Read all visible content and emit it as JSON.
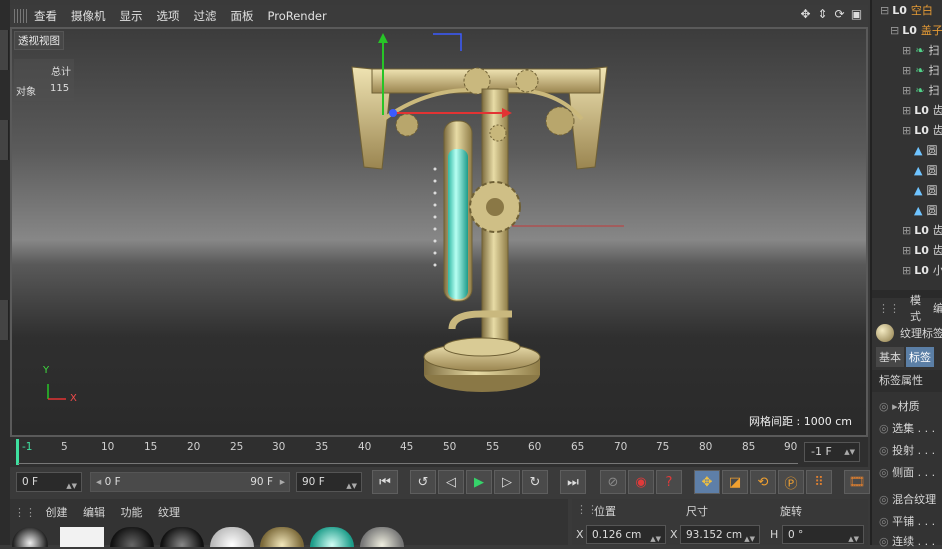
{
  "menu": [
    "查看",
    "摄像机",
    "显示",
    "选项",
    "过滤",
    "面板",
    "ProRender"
  ],
  "viewport": {
    "label": "透视视图",
    "stats_header": "总计",
    "stats_row_label": "对象",
    "stats_row_value": "115",
    "grid_spacing": "网格间距 : 1000 cm",
    "axis_y": "Y",
    "axis_x": "X"
  },
  "object_manager": {
    "items": [
      {
        "name": "空白",
        "type": "null",
        "selected": true
      },
      {
        "name": "盖子",
        "type": "null",
        "selected": true
      },
      {
        "name": "扫",
        "type": "sweep"
      },
      {
        "name": "扫",
        "type": "sweep"
      },
      {
        "name": "扫",
        "type": "sweep"
      },
      {
        "name": "齿",
        "type": "null"
      },
      {
        "name": "齿",
        "type": "null"
      },
      {
        "name": "圆",
        "type": "primitive"
      },
      {
        "name": "圆",
        "type": "primitive"
      },
      {
        "name": "圆",
        "type": "primitive"
      },
      {
        "name": "圆",
        "type": "primitive"
      },
      {
        "name": "齿",
        "type": "null"
      },
      {
        "name": "齿",
        "type": "null"
      },
      {
        "name": "小",
        "type": "null"
      }
    ]
  },
  "attributes": {
    "tabs": [
      "模式",
      "编"
    ],
    "material_tag": "纹理标签",
    "subtabs": [
      "基本",
      "标签"
    ],
    "section": "标签属性",
    "rows": [
      "材质",
      "选集 . . .",
      "投射 . . .",
      "侧面 . . .",
      "混合纹理",
      "平铺 . . .",
      "连续 . . ."
    ]
  },
  "timeline": {
    "ticks": [
      "0",
      "5",
      "10",
      "15",
      "20",
      "25",
      "30",
      "35",
      "40",
      "45",
      "50",
      "55",
      "60",
      "65",
      "70",
      "75",
      "80",
      "85",
      "90"
    ],
    "current_frame": "-1",
    "end_display": "-1 F"
  },
  "transport": {
    "start": "0 F",
    "range_start": "0 F",
    "range_end": "90 F",
    "end": "90 F"
  },
  "material_manager": {
    "menu": [
      "创建",
      "编辑",
      "功能",
      "纹理"
    ]
  },
  "coordinates": {
    "headers": [
      "位置",
      "尺寸",
      "旋转"
    ],
    "x_label": "X",
    "pos_x": "0.126 cm",
    "size_x": "93.152 cm",
    "rot_label": "H",
    "rot_h": "0 °"
  },
  "colors": {
    "accent": "#e49a35",
    "viewport_bg": "#6a6a6a",
    "timeline_bg": "#2f2f2f"
  }
}
